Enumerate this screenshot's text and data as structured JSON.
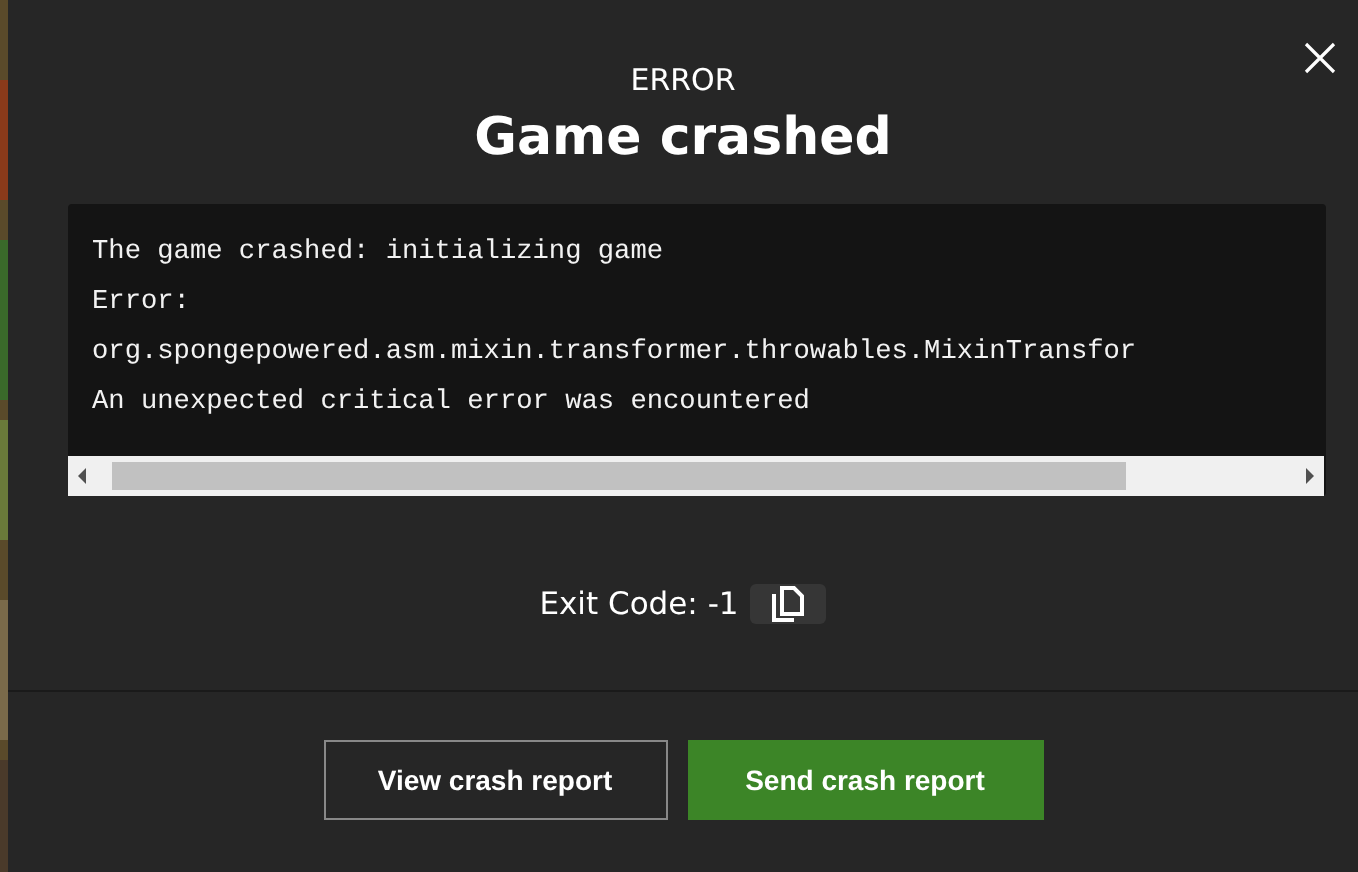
{
  "dialog": {
    "kicker": "ERROR",
    "title": "Game crashed",
    "log_lines": [
      "The game crashed: initializing game",
      "Error:",
      "org.spongepowered.asm.mixin.transformer.throwables.MixinTransfor",
      "An unexpected critical error was encountered"
    ],
    "exit_code": "Exit Code: -1",
    "buttons": [
      {
        "label": "View crash report",
        "kind": "secondary"
      },
      {
        "label": "Send crash report",
        "kind": "primary"
      }
    ]
  }
}
